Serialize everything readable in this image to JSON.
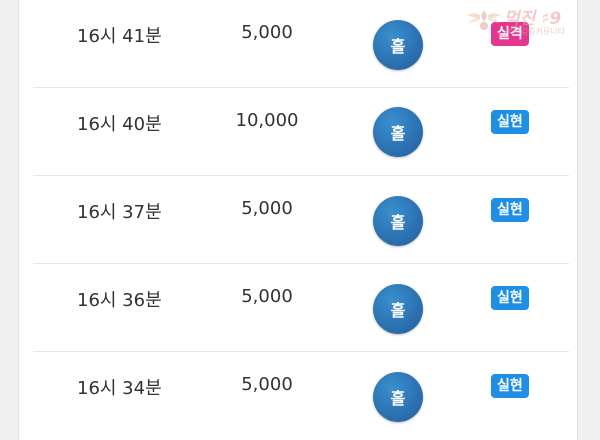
{
  "rows": [
    {
      "time": "16시 41분",
      "amount": "5,000",
      "pick": "홀",
      "result": "실격",
      "result_color": "#e4368f"
    },
    {
      "time": "16시 40분",
      "amount": "10,000",
      "pick": "홀",
      "result": "실현",
      "result_color": "#1f8fe6"
    },
    {
      "time": "16시 37분",
      "amount": "5,000",
      "pick": "홀",
      "result": "실현",
      "result_color": "#1f8fe6"
    },
    {
      "time": "16시 36분",
      "amount": "5,000",
      "pick": "홀",
      "result": "실현",
      "result_color": "#1f8fe6"
    },
    {
      "time": "16시 34분",
      "amount": "5,000",
      "pick": "홀",
      "result": "실현",
      "result_color": "#1f8fe6"
    }
  ],
  "watermark": {
    "brand": "먹진 ♯9",
    "tagline": "먹튀검증커뮤니티",
    "icon": "winged-badge-icon"
  },
  "colors": {
    "ball": "#2c73b3",
    "badge_fail": "#e4368f",
    "badge_ok": "#1f8fe6"
  }
}
